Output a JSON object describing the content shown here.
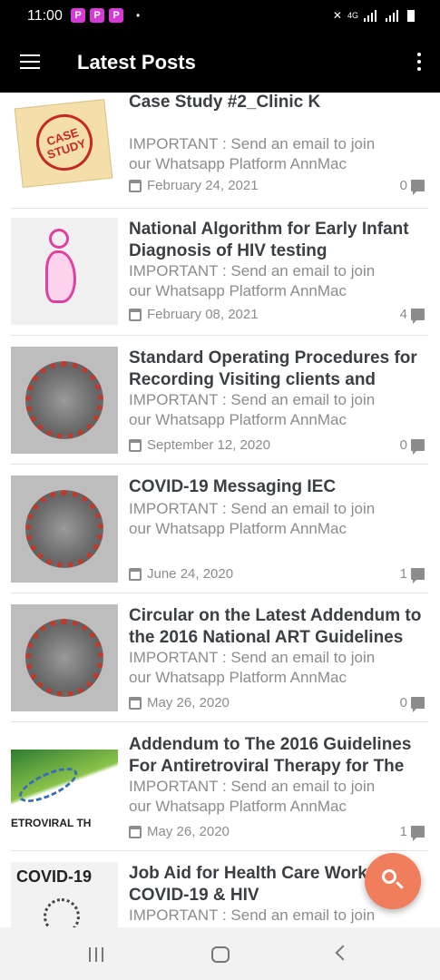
{
  "status_bar": {
    "time": "11:00",
    "badges": [
      "P",
      "P",
      "P"
    ],
    "dot": "•",
    "network": "4G"
  },
  "app_bar": {
    "title": "Latest Posts",
    "menu_icon": "hamburger-icon",
    "overflow_icon": "more-vertical-icon"
  },
  "posts": [
    {
      "title": "Case Study #2_Clinic K",
      "excerpt": "IMPORTANT : Send an email to join our Whatsapp Platform AnnMac",
      "date": "February 24, 2021",
      "comments": "0",
      "thumb_text": "CASE STUDY"
    },
    {
      "title": "National Algorithm for Early Infant Diagnosis of HIV testing",
      "excerpt": "IMPORTANT : Send an email to join our Whatsapp Platform AnnMac",
      "date": "February 08, 2021",
      "comments": "4",
      "thumb_text": ""
    },
    {
      "title": "Standard Operating Procedures for Recording Visiting clients and",
      "excerpt": "IMPORTANT : Send an email to join our Whatsapp Platform AnnMac",
      "date": "September 12, 2020",
      "comments": "0",
      "thumb_text": ""
    },
    {
      "title": "COVID-19 Messaging IEC",
      "excerpt": "IMPORTANT : Send an email to join our Whatsapp Platform AnnMac",
      "date": "June 24, 2020",
      "comments": "1",
      "thumb_text": ""
    },
    {
      "title": "Circular on the Latest Addendum to the 2016 National ART Guidelines",
      "excerpt": "IMPORTANT : Send an email to join our Whatsapp Platform AnnMac",
      "date": "May 26, 2020",
      "comments": "0",
      "thumb_text": ""
    },
    {
      "title": "Addendum to The 2016 Guidelines For Antiretroviral Therapy for The",
      "excerpt": "IMPORTANT : Send an email to join our Whatsapp Platform AnnMac",
      "date": "May 26, 2020",
      "comments": "1",
      "thumb_text": "ETROVIRAL TH"
    },
    {
      "title": "Job Aid for Health Care Workers on COVID-19 & HIV",
      "excerpt": "IMPORTANT : Send an email to join",
      "date": "",
      "comments": "",
      "thumb_text": "COVID-19"
    }
  ],
  "fab": {
    "icon": "search-icon"
  },
  "colors": {
    "accent": "#f07d5b",
    "app_bar": "#000000",
    "title_text": "#3a3f44",
    "meta_text": "#8c8c8c"
  }
}
